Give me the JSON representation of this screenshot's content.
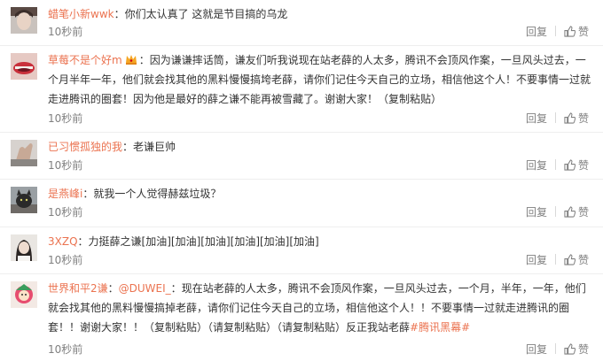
{
  "comments": [
    {
      "user": "蜡笔小新wwk",
      "text": "你们太认真了 这就是节目搞的乌龙",
      "time": "10秒前",
      "reply": "回复",
      "like": "赞",
      "avatar": "avatar-photo-face"
    },
    {
      "user": "草莓不是个好m",
      "badge_icon": "vip-badge-icon",
      "text": "因为谦谦摔话筒，谦友们听我说现在站老薛的人太多，腾讯不会顶风作案，一旦风头过去，一个月半年一年，他们就会找其他的黑料慢慢搞垮老薛，请你们记住今天自己的立场，相信他这个人！不要事情一过就走进腾讯的圈套！因为他是最好的薛之谦不能再被雪藏了。谢谢大家！（复制粘贴）",
      "time": "10秒前",
      "reply": "回复",
      "like": "赞",
      "avatar": "avatar-photo-lips"
    },
    {
      "user": "已习惯孤独的我",
      "text": "老谦巨帅",
      "time": "10秒前",
      "reply": "回复",
      "like": "赞",
      "avatar": "avatar-photo-hand"
    },
    {
      "user": "是燕峰i",
      "text": "就我一个人觉得赫兹垃圾？",
      "time": "10秒前",
      "reply": "回复",
      "like": "赞",
      "avatar": "avatar-photo-cat"
    },
    {
      "user": "3XZQ",
      "text": "力挺薛之谦[加油][加油][加油][加油][加油][加油]",
      "time": "10秒前",
      "reply": "回复",
      "like": "赞",
      "avatar": "avatar-photo-person"
    },
    {
      "user": "世界和平2谦",
      "mention": "@DUWEI_",
      "text": "现在站老薛的人太多，腾讯不会顶风作案，一旦风头过去，一个月，半年，一年，他们就会找其他的黑料慢慢搞掉老薛，请你们记住今天自己的立场，相信他这个人！！不要事情一过就走进腾讯的圈套！！谢谢大家！！（复制粘贴）（请复制粘贴）（请复制粘贴）反正我站老薛",
      "topic": "#腾讯黑幕#",
      "time": "10秒前",
      "reply": "回复",
      "like": "赞",
      "avatar": "avatar-photo-cartoon"
    }
  ],
  "colors": {
    "username": "#eb7350",
    "text": "#333333",
    "meta": "#808080",
    "divider": "#eeeeee"
  }
}
